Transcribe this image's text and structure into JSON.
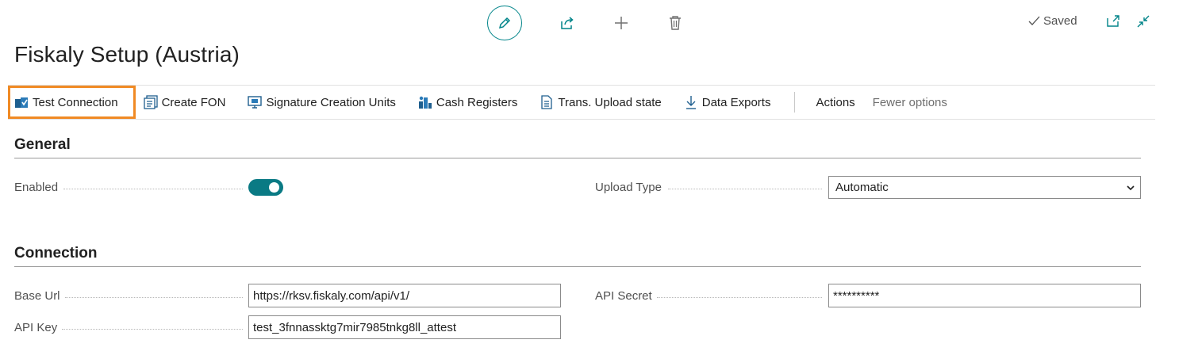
{
  "top_toolbar": {
    "edit_icon": "pencil-icon",
    "share_icon": "share-icon",
    "new_icon": "plus-icon",
    "delete_icon": "trash-icon",
    "status": "Saved",
    "status_icon": "check-icon",
    "open_new_window_icon": "open-in-new-window-icon",
    "collapse_icon": "collapse-icon"
  },
  "page": {
    "title": "Fiskaly Setup (Austria)"
  },
  "actions": [
    {
      "label": "Test Connection",
      "icon": "test-connection-icon",
      "highlighted": true
    },
    {
      "label": "Create FON",
      "icon": "create-fon-icon"
    },
    {
      "label": "Signature Creation Units",
      "icon": "signature-unit-icon"
    },
    {
      "label": "Cash Registers",
      "icon": "cash-register-icon"
    },
    {
      "label": "Trans. Upload state",
      "icon": "document-icon"
    },
    {
      "label": "Data Exports",
      "icon": "download-icon"
    },
    {
      "label": "Actions"
    },
    {
      "label": "Fewer options"
    }
  ],
  "general": {
    "title": "General",
    "enabled_label": "Enabled",
    "enabled_value": true,
    "upload_type_label": "Upload Type",
    "upload_type_value": "Automatic"
  },
  "connection": {
    "title": "Connection",
    "base_url_label": "Base Url",
    "base_url_value": "https://rksv.fiskaly.com/api/v1/",
    "api_key_label": "API Key",
    "api_key_value": "test_3fnnassktg7mir7985tnkg8ll_attest",
    "api_secret_label": "API Secret",
    "api_secret_value": "**********"
  },
  "colors": {
    "accent": "#008489",
    "toggle_on": "#0a7a84",
    "highlight_border": "#f08a24"
  }
}
